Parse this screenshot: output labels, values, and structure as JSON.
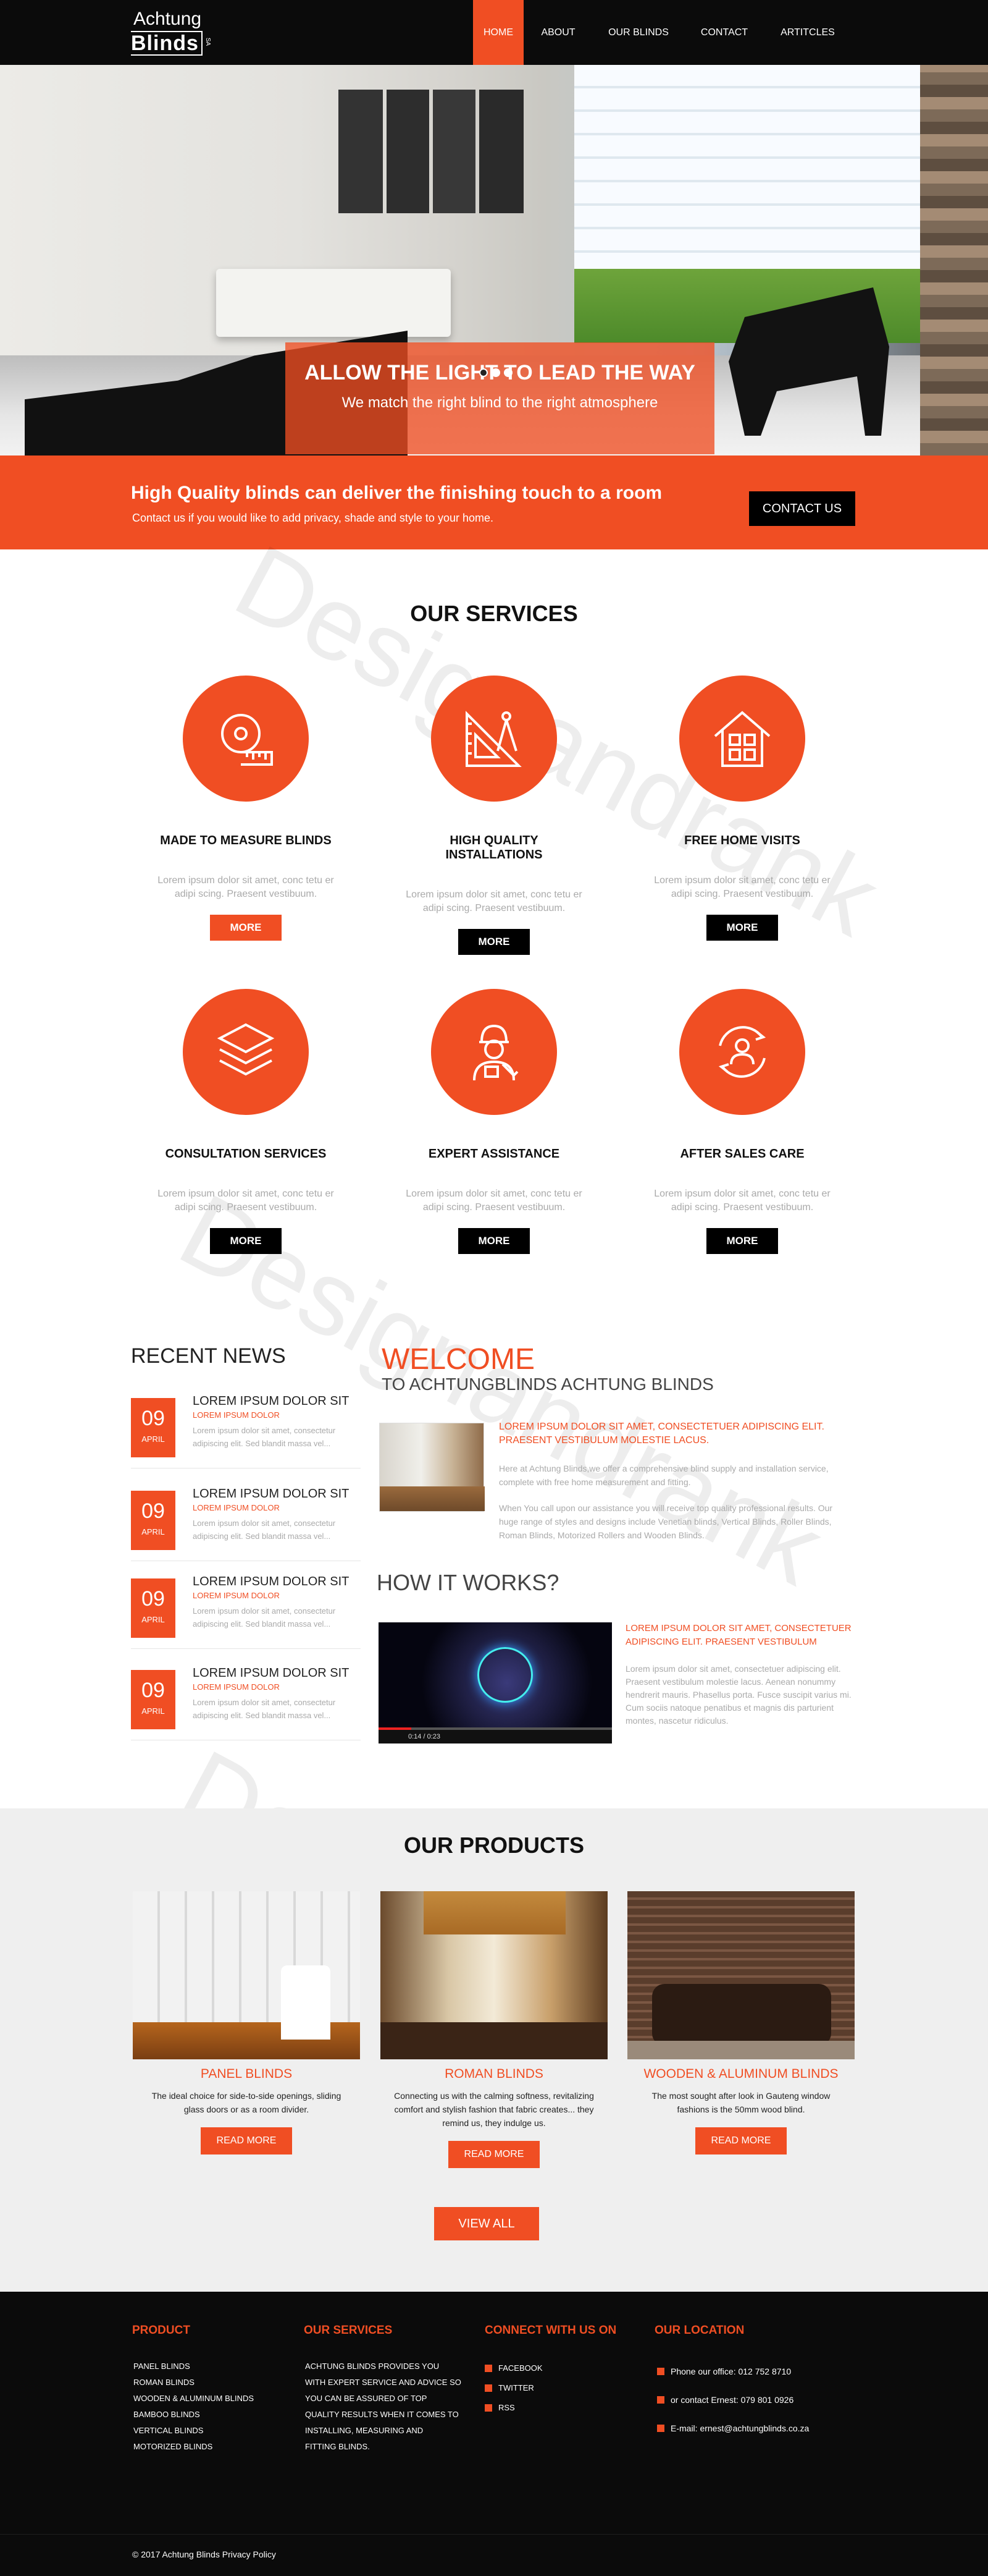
{
  "brand": {
    "logo_line1": "Achtung",
    "logo_line2": "Blinds",
    "logo_sa": "SA"
  },
  "nav": {
    "items": [
      "HOME",
      "ABOUT",
      "OUR BLINDS",
      "CONTACT",
      "ARTITCLES"
    ],
    "active": "HOME"
  },
  "hero": {
    "title": "ALLOW THE LIGHT TO LEAD THE WAY",
    "subtitle": "We match the right blind to the right atmosphere",
    "slides": 3,
    "current_slide": 1
  },
  "cta": {
    "heading": "High Quality blinds can deliver the finishing touch to a room",
    "text": "Contact us if you would like to add privacy, shade and style to your home.",
    "button": "CONTACT US"
  },
  "watermark": "Designandrank",
  "services": {
    "title": "OUR SERVICES",
    "items": [
      {
        "title": "MADE TO MEASURE BLINDS",
        "text": "Lorem ipsum dolor sit amet, conc tetu er adipi scing. Praesent vestibuum.",
        "button": "MORE",
        "icon": "measuring-tape-icon",
        "button_color": "#f04e23"
      },
      {
        "title": "HIGH QUALITY INSTALLATIONS",
        "text": "Lorem ipsum dolor sit amet, conc tetu er adipi scing. Praesent vestibuum.",
        "button": "MORE",
        "icon": "compass-ruler-icon",
        "button_color": "#000000"
      },
      {
        "title": "FREE HOME VISITS",
        "text": "Lorem ipsum dolor sit amet, conc tetu er adipi scing. Praesent vestibuum.",
        "button": "MORE",
        "icon": "house-icon",
        "button_color": "#000000"
      },
      {
        "title": "CONSULTATION SERVICES",
        "text": "Lorem ipsum dolor sit amet, conc tetu er adipi scing. Praesent vestibuum.",
        "button": "MORE",
        "icon": "layers-icon",
        "button_color": "#000000"
      },
      {
        "title": "EXPERT ASSISTANCE",
        "text": "Lorem ipsum dolor sit amet, conc tetu er adipi scing. Praesent vestibuum.",
        "button": "MORE",
        "icon": "worker-icon",
        "button_color": "#000000"
      },
      {
        "title": "AFTER SALES CARE",
        "text": "Lorem ipsum dolor sit amet, conc tetu er adipi scing. Praesent vestibuum.",
        "button": "MORE",
        "icon": "support-cycle-icon",
        "button_color": "#000000"
      }
    ]
  },
  "news": {
    "title": "RECENT NEWS",
    "items": [
      {
        "day": "09",
        "month": "APRIL",
        "title": "LOREM IPSUM DOLOR SIT",
        "subtitle": "LOREM IPSUM DOLOR",
        "text": "Lorem ipsum dolor sit amet, consectetur adipiscing elit. Sed blandit massa vel..."
      },
      {
        "day": "09",
        "month": "APRIL",
        "title": "LOREM IPSUM DOLOR SIT",
        "subtitle": "LOREM IPSUM DOLOR",
        "text": "Lorem ipsum dolor sit amet, consectetur adipiscing elit. Sed blandit massa vel..."
      },
      {
        "day": "09",
        "month": "APRIL",
        "title": "LOREM IPSUM DOLOR SIT",
        "subtitle": "LOREM IPSUM DOLOR",
        "text": "Lorem ipsum dolor sit amet, consectetur adipiscing elit. Sed blandit massa vel..."
      },
      {
        "day": "09",
        "month": "APRIL",
        "title": "LOREM IPSUM DOLOR SIT",
        "subtitle": "LOREM IPSUM DOLOR",
        "text": "Lorem ipsum dolor sit amet, consectetur adipiscing elit. Sed blandit massa vel..."
      }
    ]
  },
  "welcome": {
    "title": "WELCOME",
    "subtitle": "TO ACHTUNGBLINDS ACHTUNG BLINDS",
    "heading": "LOREM IPSUM DOLOR SIT AMET, CONSECTETUER ADIPISCING ELIT. PRAESENT VESTIBULUM MOLESTIE LACUS.",
    "para1": "Here at Achtung Blinds,we offer a comprehensive blind supply and installation service, complete with free home measurement and fitting.",
    "para2": "When You call upon our assistance you will receive top quality professional results. Our huge range of styles and designs include Venetian blinds, Vertical Blinds, Roller Blinds, Roman Blinds, Motorized Rollers and Wooden Blinds."
  },
  "how": {
    "title": "HOW IT WORKS?",
    "video_time": "0:14 / 0:23",
    "video_progress": 0.14,
    "heading": "LOREM IPSUM DOLOR SIT AMET, CONSECTETUER ADIPISCING ELIT. PRAESENT VESTIBULUM",
    "text": "Lorem ipsum dolor sit amet, consectetuer adipiscing elit. Praesent vestibulum molestie lacus. Aenean nonummy hendrerit mauris. Phasellus porta. Fusce suscipit varius mi. Cum sociis natoque penatibus et magnis dis parturient montes, nascetur ridiculus."
  },
  "products": {
    "title": "OUR PRODUCTS",
    "items": [
      {
        "title": "PANEL BLINDS",
        "text": "The ideal choice for side-to-side openings, sliding glass doors or as a room divider.",
        "button": "READ MORE"
      },
      {
        "title": "ROMAN BLINDS",
        "text": "Connecting us with the calming softness, revitalizing comfort and stylish fashion that fabric creates... they remind us, they indulge us.",
        "button": "READ MORE"
      },
      {
        "title": "WOODEN & ALUMINUM BLINDS",
        "text": "The most sought after look in Gauteng window fashions is the 50mm wood blind.",
        "button": "READ MORE"
      }
    ],
    "view_all": "VIEW ALL"
  },
  "footer": {
    "product": {
      "title": "PRODUCT",
      "items": [
        "PANEL BLINDS",
        "ROMAN BLINDS",
        "WOODEN & ALUMINUM BLINDS",
        "BAMBOO BLINDS",
        "VERTICAL BLINDS",
        "MOTORIZED BLINDS"
      ]
    },
    "services": {
      "title": "OUR SERVICES",
      "lines": [
        "ACHTUNG BLINDS PROVIDES YOU",
        "WITH EXPERT SERVICE AND ADVICE SO",
        "YOU CAN BE ASSURED OF TOP",
        "QUALITY RESULTS WHEN IT COMES TO",
        "INSTALLING, MEASURING AND",
        "FITTING BLINDS."
      ]
    },
    "connect": {
      "title": "CONNECT WITH US ON",
      "items": [
        "FACEBOOK",
        "TWITTER",
        "RSS"
      ]
    },
    "location": {
      "title": "OUR LOCATION",
      "phone": "Phone our office: 012 752 8710",
      "mobile": "or contact Ernest: 079 801 0926",
      "email": "E-mail: ernest@achtungblinds.co.za"
    },
    "copyright": "© 2017 Achtung Blinds Privacy Policy"
  },
  "colors": {
    "accent": "#f04e23",
    "dark": "#0b0b0b",
    "grey_bg": "#efefef"
  }
}
